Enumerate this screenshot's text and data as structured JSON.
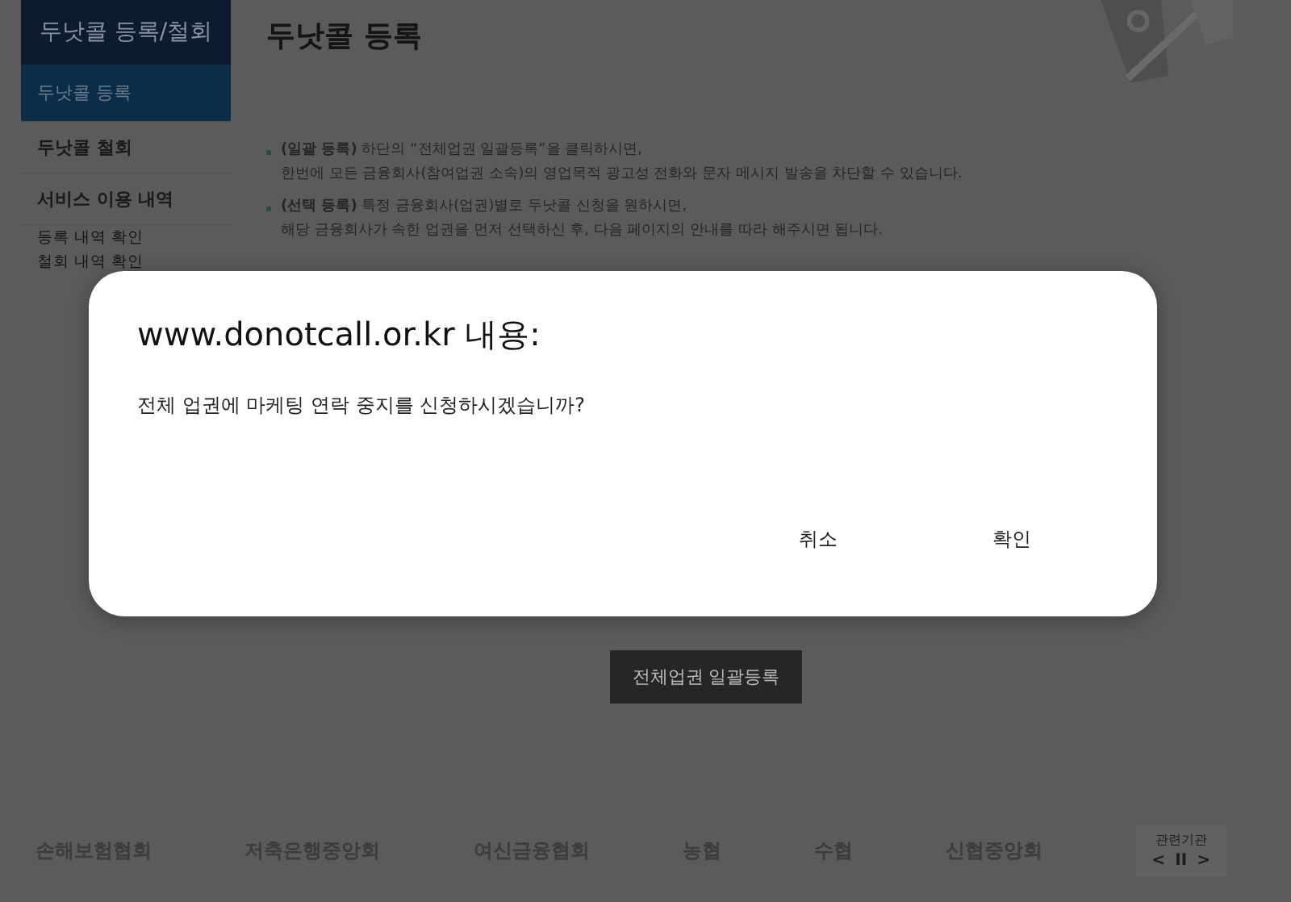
{
  "sidebar": {
    "title": "두낫콜 등록/철회",
    "items": [
      {
        "label": "두낫콜 등록",
        "selected": true,
        "kind": "main"
      },
      {
        "label": "두낫콜 철회",
        "selected": false,
        "kind": "main"
      },
      {
        "label": "서비스 이용 내역",
        "selected": false,
        "kind": "main"
      },
      {
        "label": "등록 내역 확인",
        "selected": false,
        "kind": "sub"
      },
      {
        "label": "철회 내역 확인",
        "selected": false,
        "kind": "sub"
      }
    ]
  },
  "page_title": "두낫콜 등록",
  "bullets": [
    {
      "lines": [
        "**(일괄 등록)** 하단의 “전체업권 일괄등록”을 클릭하시면,",
        "한번에 모든 금융회사(참여업권 소속)의 영업목적 광고성 전화와 문자 메시지 발송을 차단할 수 있습니다."
      ]
    },
    {
      "lines": [
        "**(선택 등록)** 특정 금융회사(업권)별로 두낫콜 신청을 원하시면,",
        "해당 금융회사가 속한 업권을 먼저 선택하신 후, 다음 페이지의 안내를 따라 해주시면 됩니다."
      ]
    }
  ],
  "main_button": "전체업권 일괄등록",
  "footer": {
    "logos": [
      "손해보험협회",
      "저축은행중앙회",
      "여신금융협회",
      "농협",
      "수협",
      "신협중앙회"
    ],
    "related": {
      "label": "관련기관",
      "prev": "<",
      "pause": "II",
      "next": ">"
    }
  },
  "dialog": {
    "title": "www.donotcall.or.kr 내용:",
    "message": "전체 업권에 마케팅 연락 중지를 신청하시겠습니까?",
    "buttons": [
      "취소",
      "확인"
    ]
  }
}
